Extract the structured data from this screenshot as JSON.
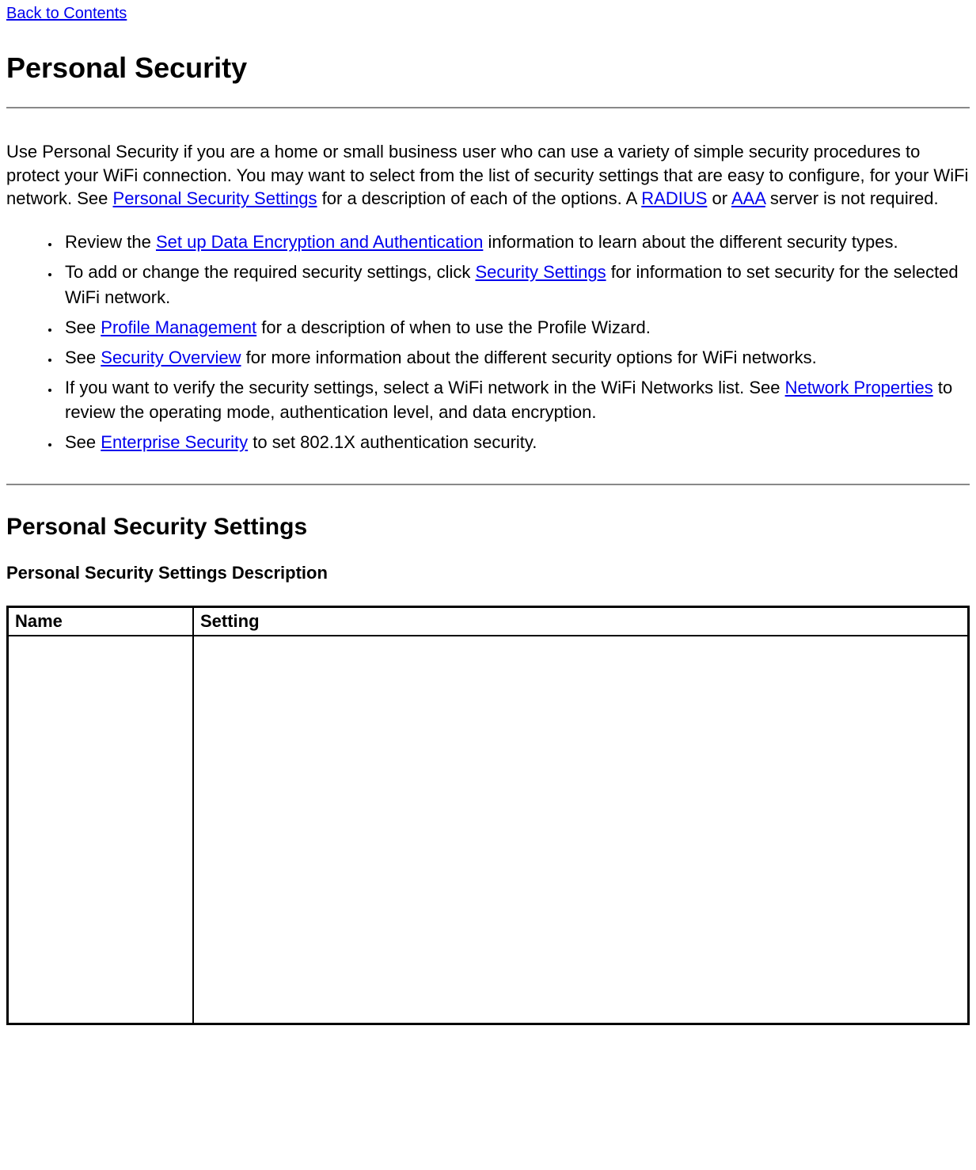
{
  "nav": {
    "back_link": "Back to Contents"
  },
  "title": "Personal Security",
  "intro": {
    "p1a": "Use Personal Security if you are a home or small business user who can use a variety of simple security procedures to protect your WiFi connection. You may want to select from the list of security settings that are easy to configure, for your WiFi network. See ",
    "link_pss": "Personal Security Settings",
    "p1b": " for a description of each of the options. A ",
    "link_radius": "RADIUS",
    "p1c": " or ",
    "link_aaa": "AAA",
    "p1d": " server is not required."
  },
  "bullets": [
    {
      "pre": "Review the ",
      "link": "Set up Data Encryption and Authentication",
      "post": " information to learn about the different security types."
    },
    {
      "pre": "To add or change the required security settings, click ",
      "link": "Security Settings",
      "post": " for information to set security for the selected WiFi network."
    },
    {
      "pre": "See ",
      "link": "Profile Management",
      "post": " for a description of when to use the Profile Wizard."
    },
    {
      "pre": "See ",
      "link": "Security Overview",
      "post": " for more information about the different security options for WiFi networks."
    },
    {
      "pre": "If you want to verify the security settings, select a WiFi network in the WiFi Networks list. See ",
      "link": "Network Properties",
      "post": " to review the operating mode, authentication level, and data encryption."
    },
    {
      "pre": "See ",
      "link": "Enterprise Security",
      "post": " to set 802.1X authentication security."
    }
  ],
  "section2": {
    "title": "Personal Security Settings",
    "subtitle": "Personal Security Settings Description"
  },
  "table": {
    "headers": {
      "name": "Name",
      "setting": "Setting"
    }
  }
}
